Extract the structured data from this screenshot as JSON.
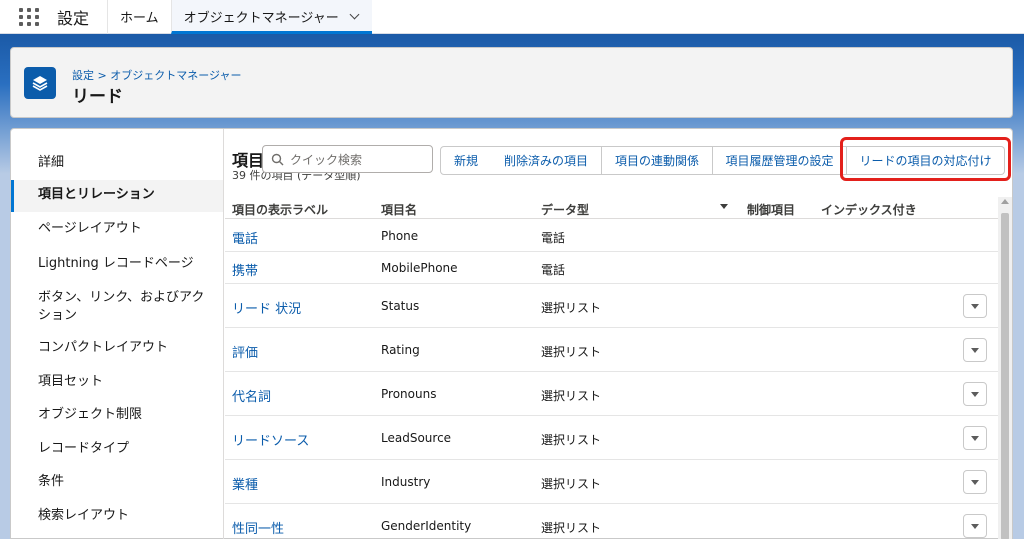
{
  "topnav": {
    "app_name": "設定",
    "tabs": [
      {
        "label": "ホーム"
      },
      {
        "label": "オブジェクトマネージャー"
      }
    ]
  },
  "header": {
    "breadcrumb": "設定 > オブジェクトマネージャー",
    "title": "リード"
  },
  "sidebar": {
    "items": [
      {
        "label": "詳細"
      },
      {
        "label": "項目とリレーション"
      },
      {
        "label": "ページレイアウト"
      },
      {
        "label": "Lightning レコードページ"
      },
      {
        "label": "ボタン、リンク、およびアクション"
      },
      {
        "label": "コンパクトレイアウト"
      },
      {
        "label": "項目セット"
      },
      {
        "label": "オブジェクト制限"
      },
      {
        "label": "レコードタイプ"
      },
      {
        "label": "条件"
      },
      {
        "label": "検索レイアウト"
      }
    ]
  },
  "section": {
    "title": "項目",
    "subtitle": "39 件の項目 (データ型順)",
    "search_placeholder": "クイック検索"
  },
  "toolbar": {
    "new": "新規",
    "deleted": "削除済みの項目",
    "dependencies": "項目の連動関係",
    "history": "項目履歴管理の設定",
    "map": "リードの項目の対応付け"
  },
  "table": {
    "headers": {
      "label": "項目の表示ラベル",
      "api": "項目名",
      "type": "データ型",
      "controlling": "制御項目",
      "indexed": "インデックス付き"
    },
    "rows": [
      {
        "label": "電話",
        "api": "Phone",
        "type": "電話"
      },
      {
        "label": "携帯",
        "api": "MobilePhone",
        "type": "電話"
      },
      {
        "label": "リード 状況",
        "api": "Status",
        "type": "選択リスト"
      },
      {
        "label": "評価",
        "api": "Rating",
        "type": "選択リスト"
      },
      {
        "label": "代名詞",
        "api": "Pronouns",
        "type": "選択リスト"
      },
      {
        "label": "リードソース",
        "api": "LeadSource",
        "type": "選択リスト"
      },
      {
        "label": "業種",
        "api": "Industry",
        "type": "選択リスト"
      },
      {
        "label": "性同一性",
        "api": "GenderIdentity",
        "type": "選択リスト"
      }
    ]
  },
  "colors": {
    "brand": "#0176d3",
    "link": "#0b5cab",
    "highlight": "#e3201b"
  }
}
